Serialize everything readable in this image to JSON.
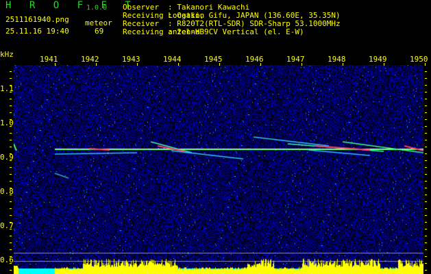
{
  "app": {
    "title": "H R O F F T",
    "version": "1.0.0"
  },
  "file": {
    "name": "2511161940.png",
    "datetime": "25.11.16 19:40"
  },
  "meteor": {
    "label": "meteor",
    "count": "69"
  },
  "info": [
    {
      "label": "Observer",
      "value": ": Takanori Kawachi"
    },
    {
      "label": "Receiving Location",
      "value": ": Ogaki, Gifu, JAPAN (136.60E, 35.35N)"
    },
    {
      "label": "Receiver",
      "value": ": R820T2(RTL-SDR) SDR-Sharp 53.1000MHz"
    },
    {
      "label": "Receiving antenna",
      "value": ": 2el-HB9CV Vertical (el. E-W)"
    }
  ],
  "axis": {
    "y_unit": "kHz",
    "y_ticks": [
      "1.1",
      "1.0",
      "0.9",
      "0.8",
      "0.7",
      "0.6"
    ],
    "x_ticks": [
      "1941",
      "1942",
      "1943",
      "1944",
      "1945",
      "1946",
      "1947",
      "1948",
      "1949",
      "1950"
    ]
  },
  "colors": {
    "text": "#ffff00",
    "title": "#22dd22",
    "background": "#000080",
    "level": "#ffff00",
    "level_base": "#00ffff"
  }
}
